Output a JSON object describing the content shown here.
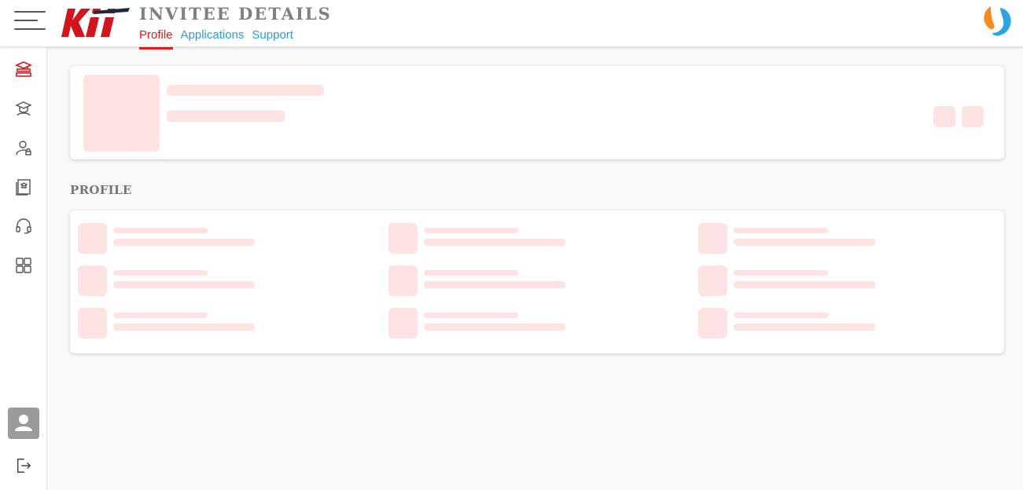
{
  "header": {
    "title": "INVITEE DETAILS",
    "brand_logo_icon": "kii-logo-icon",
    "corner_logo_icon": "partner-swirl-logo-icon",
    "tabs": [
      {
        "label": "Profile",
        "active": true
      },
      {
        "label": "Applications",
        "active": false
      },
      {
        "label": "Support",
        "active": false
      }
    ]
  },
  "sidebar": {
    "items": [
      {
        "icon": "books-stack-icon",
        "active": true
      },
      {
        "icon": "graduate-icon",
        "active": false
      },
      {
        "icon": "user-lock-icon",
        "active": false
      },
      {
        "icon": "certificate-icon",
        "active": false
      },
      {
        "icon": "headset-icon",
        "active": false
      },
      {
        "icon": "dashboard-grid-icon",
        "active": false
      }
    ],
    "bottom": [
      {
        "icon": "user-avatar-icon"
      },
      {
        "icon": "logout-icon"
      }
    ]
  },
  "main": {
    "section_title": "PROFILE",
    "loading": true
  },
  "colors": {
    "accent_red": "#e01b1b",
    "link_blue": "#2a9fd8",
    "skeleton": "#fde3e3",
    "background": "#f8f8f8"
  }
}
